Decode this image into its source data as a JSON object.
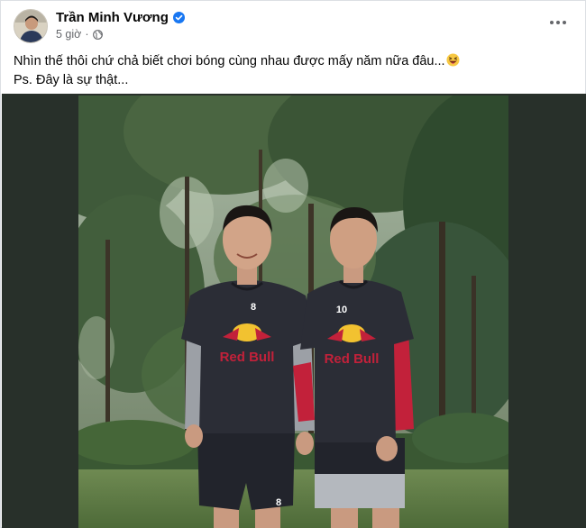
{
  "post": {
    "author": {
      "name": "Trần Minh Vương"
    },
    "timestamp": "5 giờ",
    "dot": "·",
    "caption": {
      "line1": "Nhìn thế thôi chứ chả biết chơi bóng cùng nhau được mấy năm nữa đâu...",
      "line2": "Ps. Đây là sự thật..."
    },
    "photo": {
      "left_player": {
        "jersey_number": "8",
        "shorts_number": "8",
        "sponsor": "Red Bull"
      },
      "right_player": {
        "jersey_number": "10",
        "sponsor": "Red Bull"
      }
    }
  },
  "colors": {
    "verified_badge": "#1877f2",
    "secondary_text": "#65676b",
    "jersey": "#2b2d36",
    "sleeve_red": "#c2213a"
  },
  "icons": [
    "verified-badge-icon",
    "globe-icon",
    "more-options-icon",
    "laughing-emoji-icon"
  ]
}
